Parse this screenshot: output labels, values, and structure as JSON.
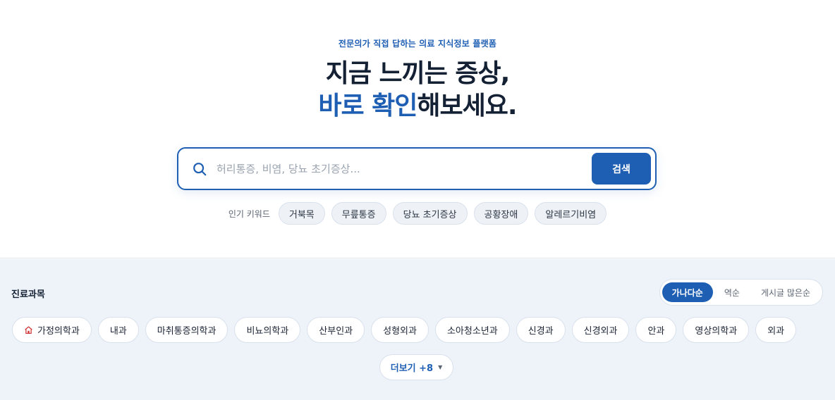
{
  "hero": {
    "tagline": "전문의가 직접 답하는 의료 지식정보 플랫폼",
    "headline_line1": "지금 느끼는 증상,",
    "headline_accent": "바로 확인",
    "headline_rest": "해보세요."
  },
  "search": {
    "placeholder": "허리통증, 비염, 당뇨 초기증상...",
    "value": "",
    "button_label": "검색",
    "icon": "search-icon"
  },
  "popular_keywords": {
    "label": "인기 키워드",
    "items": [
      "거북목",
      "무릎통증",
      "당뇨 초기증상",
      "공황장애",
      "알레르기비염"
    ]
  },
  "departments": {
    "title": "진료과목",
    "sort_options": [
      "가나다순",
      "역순",
      "게시글 많은순"
    ],
    "active_sort": "가나다순",
    "items": [
      "가정의학과",
      "내과",
      "마취통증의학과",
      "비뇨의학과",
      "산부인과",
      "성형외과",
      "소아청소년과",
      "신경과",
      "신경외과",
      "안과",
      "영상의학과",
      "외과"
    ],
    "first_item_icon": "home-icon",
    "more_label": "더보기 +8",
    "more_icon": "caret-down-icon"
  },
  "colors": {
    "accent": "#1e5fb3",
    "heading": "#142033",
    "section_bg": "#eef3f9",
    "chip_bg": "#eef2f7",
    "home_icon": "#d23b3b"
  }
}
